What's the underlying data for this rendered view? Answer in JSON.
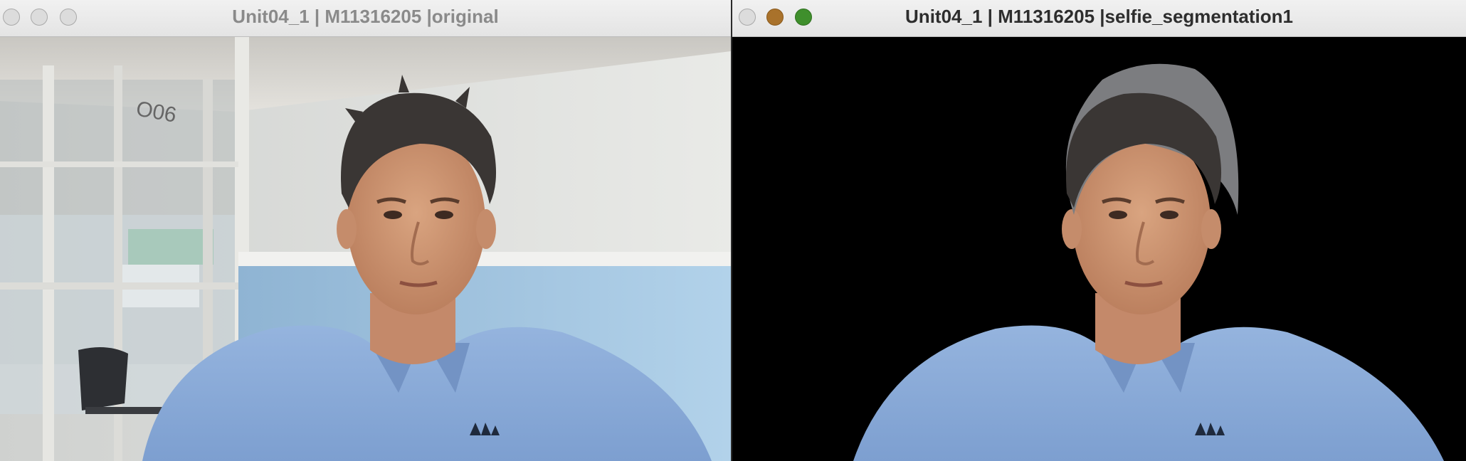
{
  "windows": [
    {
      "title": "Unit04_1 | M11316205 |original",
      "frame": {
        "type": "webcam-frame",
        "content": "original camera image"
      }
    },
    {
      "title": "Unit04_1 | M11316205 |selfie_segmentation1",
      "frame": {
        "type": "webcam-frame",
        "content": "segmented person on black background"
      }
    }
  ],
  "scene": {
    "door_number": "O06",
    "shirt_color": "#8fb0dc",
    "wall_blue": "#a9c9e6",
    "mask_background": "#000000"
  }
}
